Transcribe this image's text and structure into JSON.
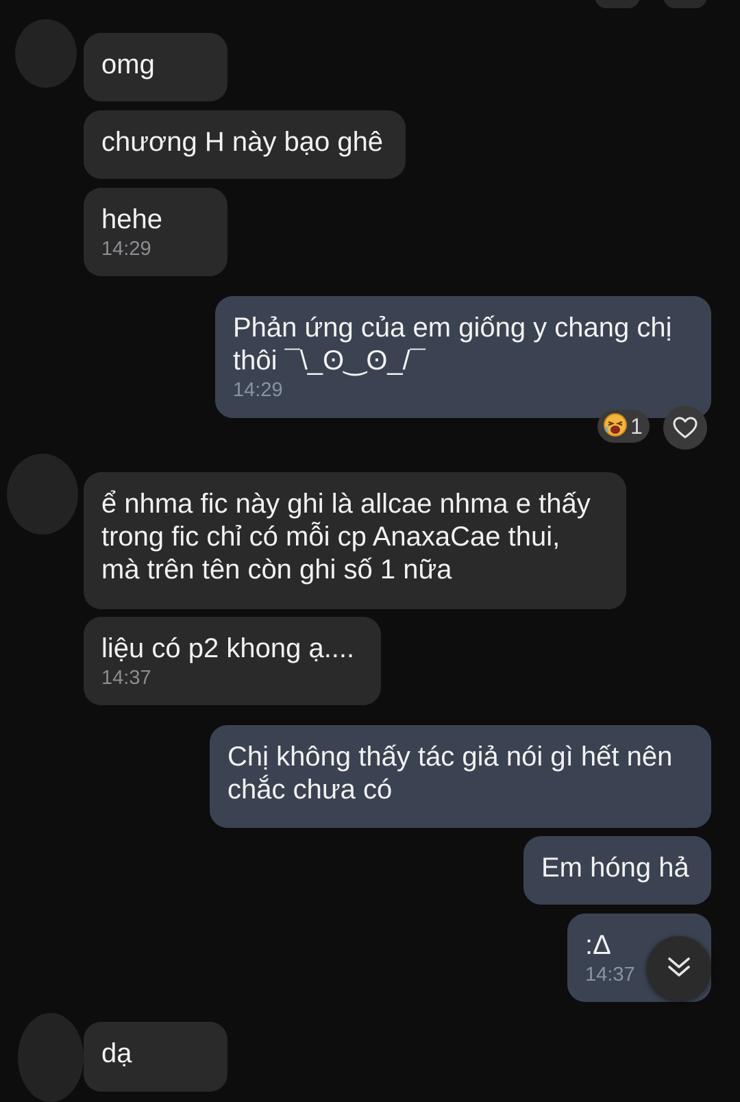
{
  "messages": [
    {
      "text": "omg"
    },
    {
      "text": "chương H này bạo ghê"
    },
    {
      "text": "hehe",
      "time": "14:29"
    },
    {
      "text": "Phản ứng của em giống y chang chị\nthôi ¯\\_ʘ‿ʘ_/¯",
      "time": "14:29"
    },
    {
      "text": "ể nhma fic này ghi là allcae nhma e thấy\ntrong fic chỉ có mỗi cp AnaxaCae thui,\nmà trên tên còn ghi số 1 nữa"
    },
    {
      "text": "liệu có p2 khong ạ....",
      "time": "14:37"
    },
    {
      "text": "Chị không thấy tác giả nói gì hết nên\nchắc chưa có"
    },
    {
      "text": "Em hóng hả"
    },
    {
      "text": ":Δ",
      "time": "14:37"
    },
    {
      "text": "dạ"
    }
  ],
  "reaction": {
    "emoji_icon": "laughing-face-icon",
    "count": "1"
  },
  "icons": {
    "like": "heart-icon",
    "scroll": "double-chevron-down-icon"
  },
  "colors": {
    "background": "#0d0d0d",
    "incoming_bubble": "#2a2a2a",
    "outgoing_bubble": "#3b4352"
  }
}
